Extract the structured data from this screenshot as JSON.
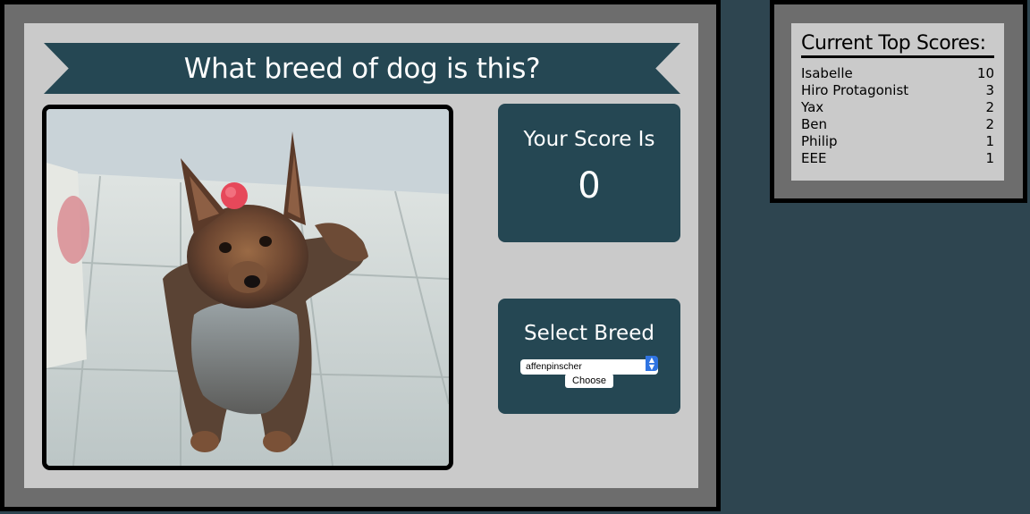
{
  "game": {
    "title": "What breed of dog is this?",
    "score_label": "Your Score Is",
    "score_value": "0",
    "select_label": "Select Breed",
    "breed_select": {
      "selected": "affenpinscher",
      "options": [
        "affenpinscher"
      ]
    },
    "choose_label": "Choose"
  },
  "leaderboard": {
    "title": "Current Top Scores:",
    "entries": [
      {
        "name": "Isabelle",
        "score": "10"
      },
      {
        "name": "Hiro Protagonist",
        "score": "3"
      },
      {
        "name": "Yax",
        "score": "2"
      },
      {
        "name": "Ben",
        "score": "2"
      },
      {
        "name": "Philip",
        "score": "1"
      },
      {
        "name": "EEE",
        "score": "1"
      }
    ]
  },
  "colors": {
    "page_bg": "#2e4550",
    "frame_gray": "#6d6d6d",
    "panel_gray": "#cacaca",
    "card_teal": "#254753",
    "select_accent": "#2f74e2"
  }
}
